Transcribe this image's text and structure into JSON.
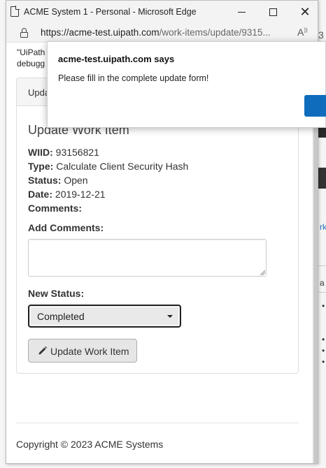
{
  "window": {
    "title": "ACME System 1 - Personal - Microsoft Edge",
    "url_host": "https://acme-test.uipath.com",
    "url_path": "/work-items/update/9315..."
  },
  "page": {
    "notice_line1": "\"UiPath",
    "notice_line2": "debugg",
    "card_header": "Upda",
    "form_title": "Update Work Item",
    "fields": {
      "wiid_label": "WIID:",
      "wiid_value": "93156821",
      "type_label": "Type:",
      "type_value": "Calculate Client Security Hash",
      "status_label": "Status:",
      "status_value": "Open",
      "date_label": "Date:",
      "date_value": "2019-12-21",
      "comments_label": "Comments:"
    },
    "add_comments_label": "Add Comments:",
    "add_comments_value": "",
    "new_status_label": "New Status:",
    "new_status_value": "Completed",
    "update_button_label": "Update Work Item",
    "footer": "Copyright © 2023 ACME Systems"
  },
  "dialog": {
    "title": "acme-test.uipath.com says",
    "message": "Please fill in the complete update form!"
  },
  "background": {
    "num": "3",
    "link_char": "rk",
    "text_char": "a"
  },
  "colors": {
    "accent": "#0f6cbd",
    "bg_dark": "#2b2b2b"
  }
}
